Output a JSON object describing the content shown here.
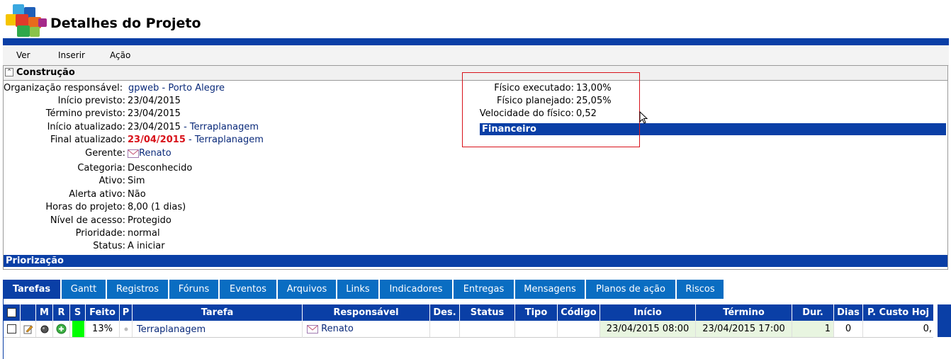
{
  "header": {
    "title": "Detalhes do Projeto"
  },
  "menu": [
    "Ver",
    "Inserir",
    "Ação"
  ],
  "panel": {
    "title": "Construção",
    "fields": [
      {
        "label": "Organização responsável:",
        "value": "gpweb - Porto Alegre"
      },
      {
        "label": "Início previsto:",
        "value": "23/04/2015"
      },
      {
        "label": "Término previsto:",
        "value": "23/04/2015"
      },
      {
        "label": "Início atualizado:",
        "value": "23/04/2015",
        "extra": " - Terraplanagem"
      },
      {
        "label": "Final atualizado:",
        "value": "23/04/2015",
        "extra": " - Terraplanagem"
      },
      {
        "label": "Gerente:",
        "value": "Renato"
      },
      {
        "label": "Categoria:",
        "value": "Desconhecido"
      },
      {
        "label": "Ativo:",
        "value": "Sim"
      },
      {
        "label": "Alerta ativo:",
        "value": "Não"
      },
      {
        "label": "Horas do projeto:",
        "value": "8,00 (1 dias)"
      },
      {
        "label": "Nível de acesso:",
        "value": "Protegido"
      },
      {
        "label": "Prioridade:",
        "value": "normal"
      },
      {
        "label": "Status:",
        "value": "A iniciar"
      }
    ],
    "right_fields": [
      {
        "label": "Físico executado:",
        "value": "13,00%"
      },
      {
        "label": "Físico planejado:",
        "value": "25,05%"
      },
      {
        "label": "Velocidade do físico:",
        "value": "0,52"
      }
    ],
    "financeiro": "Financeiro",
    "priorizacao": "Priorização"
  },
  "tabs": [
    "Tarefas",
    "Gantt",
    "Registros",
    "Fóruns",
    "Eventos",
    "Arquivos",
    "Links",
    "Indicadores",
    "Entregas",
    "Mensagens",
    "Planos de ação",
    "Riscos"
  ],
  "table": {
    "headers": [
      "",
      "M",
      "R",
      "S",
      "Feito",
      "P",
      "Tarefa",
      "Responsável",
      "Des.",
      "Status",
      "Tipo",
      "Código",
      "Início",
      "Término",
      "Dur.",
      "Dias",
      "P. Custo Hoj"
    ],
    "row": {
      "feito": "13%",
      "tarefa": "Terraplanagem",
      "responsavel": "Renato",
      "inicio": "23/04/2015 08:00",
      "termino": "23/04/2015 17:00",
      "dur": "1",
      "dias": "0",
      "custo": "0,"
    }
  },
  "colors": {
    "accent": "#0a3fa6",
    "tab": "#0a6dc2",
    "status_green": "#00ff00",
    "red": "#d8121a"
  }
}
